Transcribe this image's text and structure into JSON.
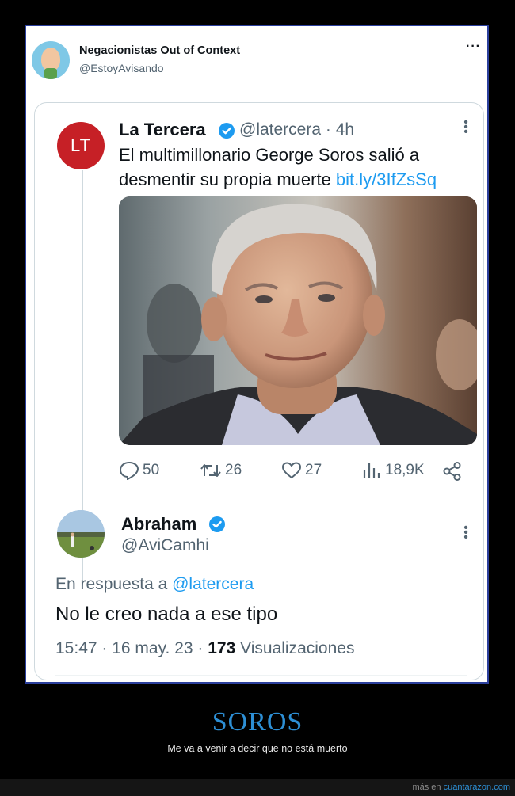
{
  "outer_tweet": {
    "author_name": "Negacionistas Out of Context",
    "author_handle": "@EstoyAvisando",
    "more_icon": "more-icon"
  },
  "quoted_tweet": {
    "avatar_text": "LT",
    "author_name": "La Tercera",
    "author_handle": "@latercera",
    "time": "· 4h",
    "text": "El multimillonario George Soros salió a desmentir su propia muerte",
    "link": "bit.ly/3IfZsSq",
    "metrics": {
      "replies": "50",
      "retweets": "26",
      "likes": "27",
      "views": "18,9K"
    }
  },
  "reply_tweet": {
    "author_name": "Abraham",
    "author_handle": "@AviCamhi",
    "reply_to_prefix": "En respuesta a",
    "reply_to_mention": "@latercera",
    "text": "No le creo nada a ese tipo",
    "meta_prefix": "15:47 · 16 may. 23 ·",
    "views_count": "173",
    "views_label": "Visualizaciones"
  },
  "caption": {
    "title": "SOROS",
    "subtitle": "Me va a venir a decir que no está muerto"
  },
  "footer": {
    "prefix": "más en",
    "site": "cuantarazon.com"
  },
  "colors": {
    "accent": "#1d9bf0",
    "caption": "#2d8fd5",
    "lt_red": "#c62026"
  }
}
